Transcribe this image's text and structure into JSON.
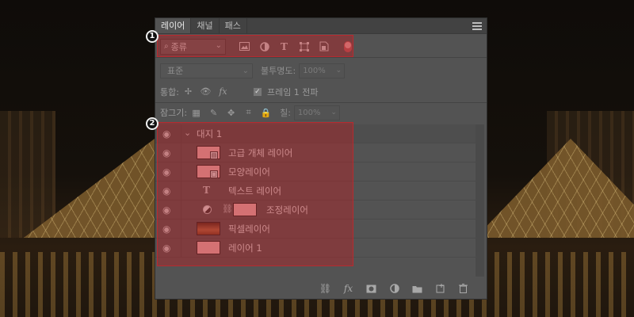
{
  "panel": {
    "tabs": [
      {
        "label": "레이어"
      },
      {
        "label": "채널"
      },
      {
        "label": "패스"
      }
    ]
  },
  "filter": {
    "kind_icon": "search-icon",
    "kind_label": "종류",
    "icons": [
      "image-icon",
      "adjustment-icon",
      "type-icon",
      "shape-icon",
      "smart-object-icon",
      "filter-toggle-icon"
    ]
  },
  "blend": {
    "mode": "표준",
    "opacity_label": "불투명도:",
    "opacity_value": "100%"
  },
  "unify": {
    "label": "통합:",
    "frame_label": "프레임 1 전파"
  },
  "lock": {
    "label": "잠그기:",
    "fill_label": "칠:",
    "fill_value": "100%"
  },
  "layers": [
    {
      "name": "대지 1",
      "type": "artboard"
    },
    {
      "name": "고급 개체 레이어",
      "type": "smart-object"
    },
    {
      "name": "모양레이어",
      "type": "shape"
    },
    {
      "name": "텍스트 레이어",
      "type": "text"
    },
    {
      "name": "조정레이어",
      "type": "adjustment"
    },
    {
      "name": "픽셀레이어",
      "type": "pixel"
    },
    {
      "name": "레이어 1",
      "type": "normal"
    }
  ],
  "markers": {
    "one": "1",
    "two": "2"
  },
  "colors": {
    "panel_bg": "#535353",
    "highlight": "#af2328",
    "thumb_pink": "#f5b8b8"
  }
}
